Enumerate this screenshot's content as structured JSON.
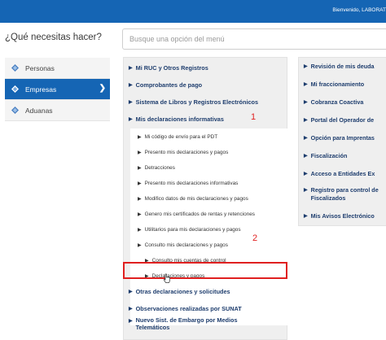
{
  "header": {
    "welcome": "Bienvenido, LABORAT"
  },
  "question": "¿Qué necesitas hacer?",
  "search": {
    "placeholder": "Busque una opción del menú"
  },
  "sidebar": {
    "items": [
      {
        "label": "Personas"
      },
      {
        "label": "Empresas"
      },
      {
        "label": "Aduanas"
      }
    ]
  },
  "menu": {
    "items": [
      {
        "label": "Mi RUC y Otros Registros"
      },
      {
        "label": "Comprobantes de pago"
      },
      {
        "label": "Sistema de Libros y Registros Electrónicos"
      },
      {
        "label": "Mis declaraciones informativas"
      },
      {
        "label": "Mi código de envío para el PDT"
      },
      {
        "label": "Presento mis declaraciones y pagos"
      },
      {
        "label": "Detracciones"
      },
      {
        "label": "Presento mis declaraciones informativas"
      },
      {
        "label": "Modifico datos de mis declaraciones y pagos"
      },
      {
        "label": "Genero mis certificados de rentas y retenciones"
      },
      {
        "label": "Utilitarios para mis declaraciones y pagos"
      },
      {
        "label": "Consulto mis declaraciones y pagos"
      },
      {
        "label": "Consulto mis cuentas de control"
      },
      {
        "label": "Declaraciones y pagos"
      },
      {
        "label": "Otras declaraciones y solicitudes"
      },
      {
        "label": "Observaciones realizadas por SUNAT"
      },
      {
        "label": "Nuevo Sist. de Embargo por Medios Telemáticos"
      }
    ]
  },
  "menu2": {
    "items": [
      {
        "label": "Revisión de mis deuda"
      },
      {
        "label": "Mi fraccionamiento"
      },
      {
        "label": "Cobranza Coactiva"
      },
      {
        "label": "Portal del Operador de"
      },
      {
        "label": "Opción para Imprentas"
      },
      {
        "label": "Fiscalización"
      },
      {
        "label": "Acceso a Entidades Ex"
      },
      {
        "label": "Registro para control de Fiscalizados"
      },
      {
        "label": "Mis Avisos Electrónico"
      }
    ]
  },
  "annotations": {
    "one": "1",
    "two": "2"
  },
  "colors": {
    "primary": "#1565b4",
    "highlight": "#e02020",
    "link": "#1f3e6e"
  }
}
